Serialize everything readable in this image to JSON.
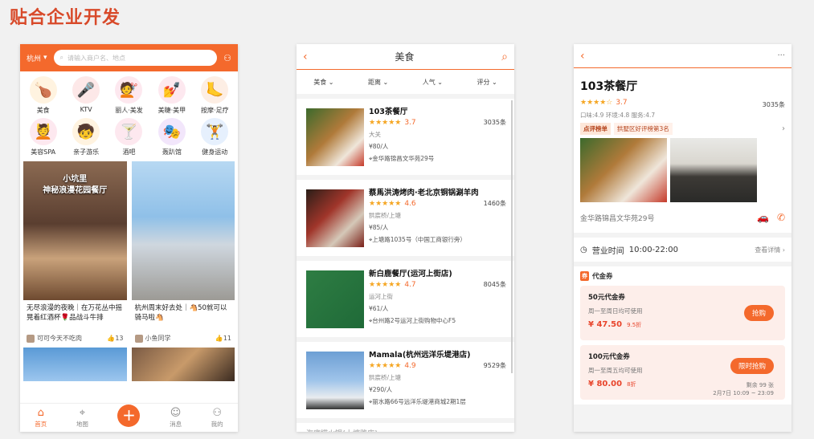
{
  "slide_title": "贴合企业开发",
  "home": {
    "city": "杭州",
    "search_placeholder": "请输入商户名、地点",
    "categories": [
      {
        "label": "美食",
        "icon": "🍗",
        "bg": "#fff3e0"
      },
      {
        "label": "KTV",
        "icon": "🎤",
        "bg": "#fde8e8"
      },
      {
        "label": "丽人·美发",
        "icon": "💇",
        "bg": "#fde8ef"
      },
      {
        "label": "美睫·美甲",
        "icon": "💅",
        "bg": "#fde8ef"
      },
      {
        "label": "按摩·足疗",
        "icon": "🦶",
        "bg": "#fdeee4"
      },
      {
        "label": "美容SPA",
        "icon": "💆",
        "bg": "#fde8ef"
      },
      {
        "label": "亲子游乐",
        "icon": "🧒",
        "bg": "#fff3e0"
      },
      {
        "label": "酒吧",
        "icon": "🍸",
        "bg": "#fde8ef"
      },
      {
        "label": "轰趴馆",
        "icon": "🎭",
        "bg": "#f2e6fb"
      },
      {
        "label": "健身运动",
        "icon": "🏋",
        "bg": "#e6f0fd"
      }
    ],
    "feed": [
      {
        "caption": "小坑里\n神秘浪漫花园餐厅",
        "text": "无尽浪漫的夜晚｜在万花丛中摇晃着红酒杯🌹品战斗牛排",
        "user": "可可今天不吃肉",
        "likes": "13"
      },
      {
        "caption": "",
        "text": "杭州周末好去处｜🐴50就可以骑马啦🐴",
        "user": "小鱼同学",
        "likes": "11"
      }
    ],
    "tabs": [
      "首页",
      "地图",
      "",
      "消息",
      "我的"
    ]
  },
  "list": {
    "title": "美食",
    "filters": [
      "美食",
      "距离",
      "人气",
      "评分"
    ],
    "restaurants": [
      {
        "name": "103茶餐厅",
        "score": "3.7",
        "count": "3035条",
        "area": "大关",
        "price": "¥80/人",
        "addr": "金华路锦昌文华苑29号",
        "thumb": "linear-gradient(135deg,#3c6a2c,#b07a3a 45%,#efe6da 75%,#c53a2a)"
      },
      {
        "name": "蔡馬洪涛烤肉·老北京铜锅涮羊肉",
        "score": "4.6",
        "count": "1460条",
        "area": "拱宸桥/上塘",
        "price": "¥85/人",
        "addr": "上塘路1035号（中国工商银行旁）",
        "thumb": "linear-gradient(135deg,#2a1e18,#a0352a 40%,#d5c8b8 70%,#7a2018)"
      },
      {
        "name": "新白鹿餐厅(运河上街店)",
        "score": "4.7",
        "count": "8045条",
        "area": "运河上街",
        "price": "¥61/人",
        "addr": "台州路2号运河上街购物中心F5",
        "thumb": "linear-gradient(135deg,#2e7d43,#1f6a38)"
      },
      {
        "name": "Mamala(杭州远洋乐堤港店)",
        "score": "4.9",
        "count": "9529条",
        "area": "拱宸桥/上塘",
        "price": "¥290/人",
        "addr": "丽水路66号远洋乐堤港商城2期1层",
        "thumb": "linear-gradient(180deg,#6d9fd4,#9fc4ea 50%,#e9ecef 80%,#333)"
      }
    ],
    "cut_name": "海底捞火锅(上塘路店)"
  },
  "detail": {
    "title": "103茶餐厅",
    "score": "3.7",
    "count": "3035条",
    "sub": "口味:4.9 环境:4.8 服务:4.7",
    "rank_badge": "点评榜单",
    "rank_text": "拱墅区好评榜第3名",
    "address": "金华路锦昌文华苑29号",
    "hours_label": "营业时间",
    "hours": "10:00-22:00",
    "hours_more": "查看详情",
    "voucher_tag": "券",
    "voucher_title": "代金券",
    "vouchers": [
      {
        "name": "50元代金券",
        "desc": "周一至周日均可使用",
        "price": "¥ 47.50",
        "discount": "9.5折",
        "button": "抢购",
        "note": ""
      },
      {
        "name": "100元代金券",
        "desc": "周一至周五均可使用",
        "price": "¥ 80.00",
        "discount": "8折",
        "button": "限时抢购",
        "note": "剩余 99 张\n2月7日 10:09 ~ 23:09"
      }
    ]
  }
}
